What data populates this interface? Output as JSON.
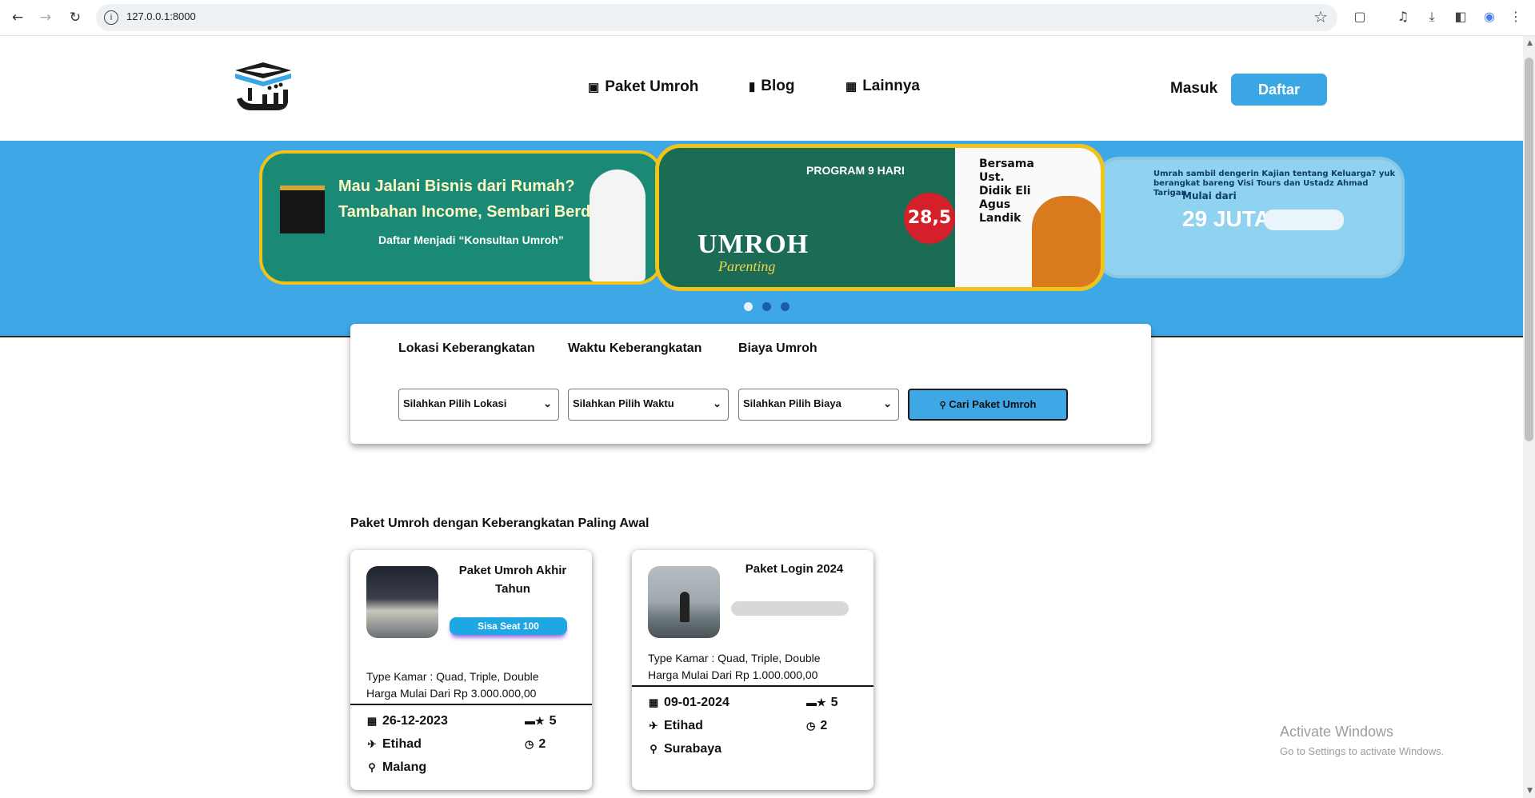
{
  "browser": {
    "url": "127.0.0.1:8000",
    "icons": [
      "back-icon",
      "forward-icon",
      "reload-icon",
      "info-icon",
      "star-icon",
      "extensions-icon",
      "media-icon",
      "download-icon",
      "sidebar-icon",
      "profile-icon",
      "menu-icon"
    ]
  },
  "header": {
    "nav": [
      {
        "label": "Paket Umroh",
        "icon": "kaaba-icon"
      },
      {
        "label": "Blog",
        "icon": "blog-icon"
      },
      {
        "label": "Lainnya",
        "icon": "grid-icon"
      }
    ],
    "login_label": "Masuk",
    "register_label": "Daftar",
    "accent": "#3aa6e4"
  },
  "hero": {
    "banner1": {
      "line1": "Mau Jalani Bisnis dari Rumah?",
      "line2": "Tambahan Income, Sembari Berdakwah",
      "line3": "Daftar Menjadi “Konsultan Umroh”"
    },
    "banner2": {
      "program": "PROGRAM 9 HARI",
      "title": "UMROH",
      "subtitle": "Parenting",
      "price": "28,5",
      "ustadz": "Bersama Ust. Didik Eli Agus Landik"
    },
    "banner3": {
      "tagline": "Umrah sambil dengerin Kajian tentang Keluarga? yuk berangkat bareng Visi Tours dan Ustadz Ahmad Tarigan",
      "from_label": "Mulai dari",
      "price": "29 JUTA"
    },
    "slides": 3,
    "active_slide": 0,
    "background": "#3ea7e5"
  },
  "search": {
    "labels": {
      "location": "Lokasi Keberangkatan",
      "time": "Waktu Keberangkatan",
      "cost": "Biaya Umroh"
    },
    "selects": {
      "location": "Silahkan Pilih Lokasi",
      "time": "Silahkan Pilih Waktu",
      "cost": "Silahkan Pilih Biaya"
    },
    "button_label": "Cari Paket Umroh"
  },
  "section": {
    "title": "Paket Umroh dengan Keberangkatan Paling Awal"
  },
  "packages": [
    {
      "name": "Paket Umroh Akhir Tahun",
      "seat": "Sisa Seat 100",
      "room": "Type Kamar : Quad, Triple, Double",
      "price": "Harga Mulai Dari Rp 3.000.000,00",
      "date": "26-12-2023",
      "airline": "Etihad",
      "city": "Malang",
      "stars": "5",
      "duration": "2"
    },
    {
      "name": "Paket Login 2024",
      "seat": "",
      "room": "Type Kamar : Quad, Triple, Double",
      "price": "Harga Mulai Dari Rp 1.000.000,00",
      "date": "09-01-2024",
      "airline": "Etihad",
      "city": "Surabaya",
      "stars": "5",
      "duration": "2"
    }
  ],
  "watermark": {
    "line1": "Activate Windows",
    "line2": "Go to Settings to activate Windows."
  }
}
